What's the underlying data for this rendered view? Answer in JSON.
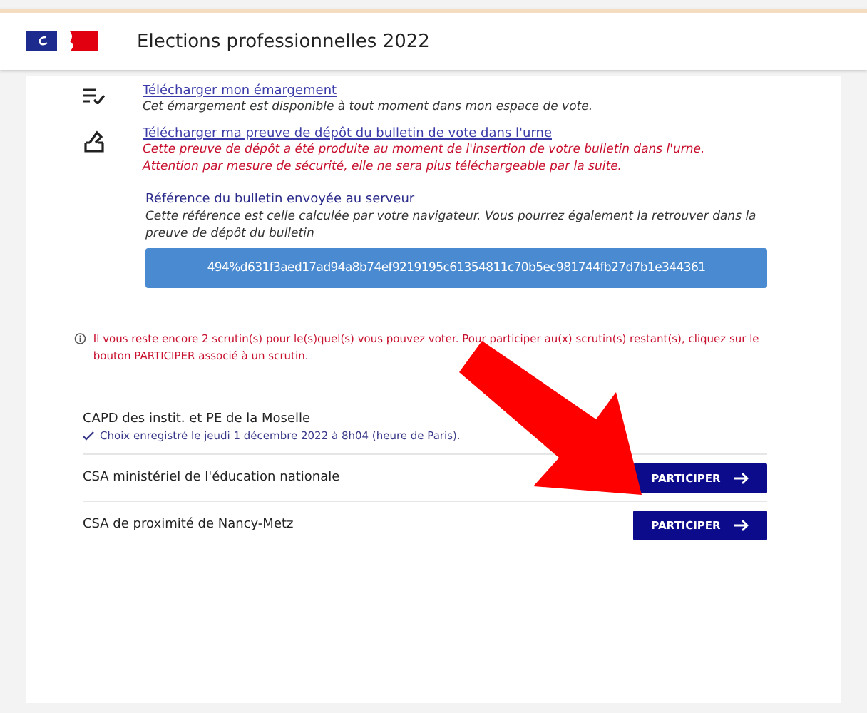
{
  "header": {
    "title": "Elections professionnelles 2022"
  },
  "downloads": [
    {
      "kind": "list",
      "link": "Télécharger mon émargement",
      "notes": [
        "Cet émargement est disponible à tout moment dans mon espace de vote."
      ],
      "warning": false
    },
    {
      "kind": "ballot",
      "link": "Télécharger ma preuve de dépôt du bulletin de vote dans l'urne",
      "notes": [
        "Cette preuve de dépôt a été produite au moment de l'insertion de votre bulletin dans l'urne.",
        "Attention par mesure de sécurité, elle ne sera plus téléchargeable par la suite."
      ],
      "warning": true
    }
  ],
  "reference": {
    "label": "Référence du bulletin envoyée au serveur",
    "note": "Cette référence est celle calculée par votre navigateur. Vous pourrez également la retrouver dans la preuve de dépôt du bulletin",
    "value": "494%d631f3aed17ad94a8b74ef9219195c61354811c70b5ec981744fb27d7b1e344361"
  },
  "info": "Il vous reste encore 2 scrutin(s) pour le(s)quel(s) vous pouvez voter. Pour participer au(x) scrutin(s) restant(s), cliquez sur le bouton PARTICIPER associé à un scrutin.",
  "scrutins": [
    {
      "kind": "done",
      "name": "CAPD des instit. et PE de la Moselle",
      "confirmation": "Choix enregistré le jeudi 1 décembre 2022 à 8h04 (heure de Paris)."
    },
    {
      "kind": "pending",
      "name": "CSA ministériel de l'éducation nationale",
      "button": "PARTICIPER"
    },
    {
      "kind": "pending",
      "name": "CSA de proximité de Nancy-Metz",
      "button": "PARTICIPER"
    }
  ]
}
